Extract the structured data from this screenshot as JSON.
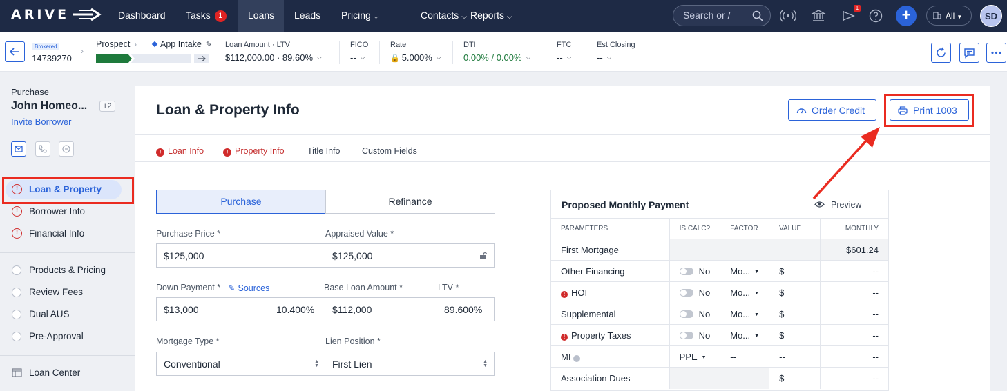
{
  "nav": {
    "logo": "ARIVE",
    "items": [
      {
        "label": "Dashboard"
      },
      {
        "label": "Tasks",
        "badge": "1"
      },
      {
        "label": "Loans"
      },
      {
        "label": "Leads"
      },
      {
        "label": "Pricing"
      },
      {
        "label": "Contacts"
      },
      {
        "label": "Reports"
      }
    ],
    "search_placeholder": "Search or /",
    "notif_badge": "1",
    "plus": "+",
    "company_filter": "All",
    "avatar": "SD"
  },
  "infobar": {
    "badge": "Brokered",
    "loan_number": "14739270",
    "stage_prev": "Prospect",
    "stage_current": "App Intake",
    "loan_amount_label": "Loan Amount · LTV",
    "loan_amount": "$112,000.00",
    "ltv": "89.60%",
    "fico_label": "FICO",
    "fico": "--",
    "rate_label": "Rate",
    "rate": "5.000%",
    "dti_label": "DTI",
    "dti": "0.00% / 0.00%",
    "ftc_label": "FTC",
    "ftc": "--",
    "est_closing_label": "Est Closing",
    "est_closing": "--"
  },
  "sidebar": {
    "purpose": "Purchase",
    "borrower": "John Homeo...",
    "extra_borrowers": "+2",
    "invite": "Invite Borrower",
    "items_primary": [
      {
        "label": "Loan & Property"
      },
      {
        "label": "Borrower Info"
      },
      {
        "label": "Financial Info"
      }
    ],
    "items_secondary": [
      {
        "label": "Products & Pricing"
      },
      {
        "label": "Review Fees"
      },
      {
        "label": "Dual AUS"
      },
      {
        "label": "Pre-Approval"
      }
    ],
    "loan_center": "Loan Center"
  },
  "page": {
    "title": "Loan & Property Info",
    "order_credit": "Order Credit",
    "print_1003": "Print 1003",
    "tabs": [
      {
        "label": "Loan Info"
      },
      {
        "label": "Property Info"
      },
      {
        "label": "Title Info"
      },
      {
        "label": "Custom Fields"
      }
    ]
  },
  "form": {
    "purpose_options": [
      "Purchase",
      "Refinance"
    ],
    "purchase_price_label": "Purchase Price *",
    "purchase_price": "$125,000",
    "appraised_value_label": "Appraised Value *",
    "appraised_value": "$125,000",
    "down_payment_label": "Down Payment *",
    "sources": "Sources",
    "down_payment": "$13,000",
    "down_payment_pct": "10.400%",
    "base_loan_label": "Base Loan Amount *",
    "base_loan": "$112,000",
    "ltv_label": "LTV *",
    "ltv": "89.600%",
    "mortgage_type_label": "Mortgage Type *",
    "mortgage_type": "Conventional",
    "lien_position_label": "Lien Position *",
    "lien_position": "First Lien"
  },
  "payment": {
    "title": "Proposed Monthly Payment",
    "preview": "Preview",
    "columns": [
      "PARAMETERS",
      "IS CALC?",
      "FACTOR",
      "VALUE",
      "MONTHLY"
    ],
    "rows": [
      {
        "param": "First Mortgage",
        "calc": "",
        "factor": "",
        "value": "",
        "monthly": "$601.24"
      },
      {
        "param": "Other Financing",
        "calc": "No",
        "factor": "Mo...",
        "value": "$",
        "monthly": "--"
      },
      {
        "param": "HOI",
        "calc": "No",
        "factor": "Mo...",
        "value": "$",
        "monthly": "--"
      },
      {
        "param": "Supplemental",
        "calc": "No",
        "factor": "Mo...",
        "value": "$",
        "monthly": "--"
      },
      {
        "param": "Property Taxes",
        "calc": "No",
        "factor": "Mo...",
        "value": "$",
        "monthly": "--"
      },
      {
        "param": "MI",
        "calc": "PPE",
        "factor": "--",
        "value": "--",
        "monthly": "--"
      },
      {
        "param": "Association Dues",
        "calc": "",
        "factor": "",
        "value": "$",
        "monthly": "--"
      }
    ]
  },
  "colors": {
    "nav_bg": "#1e2a45",
    "accent": "#2b63d9",
    "error": "#c53030",
    "annotation": "#ea2b20",
    "progress_done": "#1e7a3c"
  }
}
